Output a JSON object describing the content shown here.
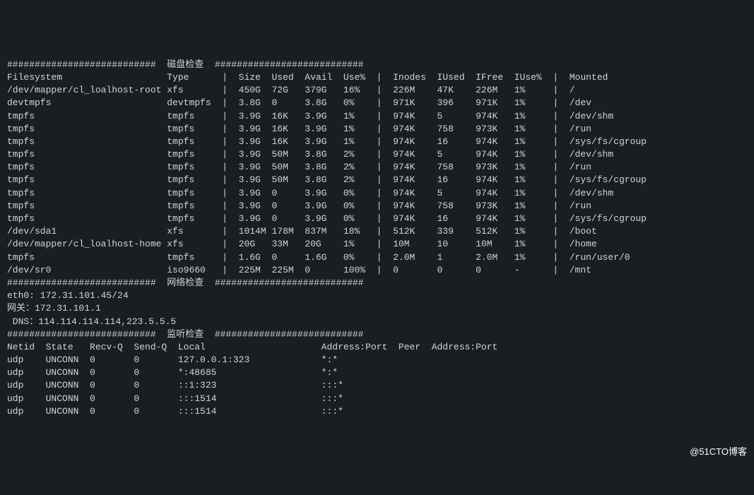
{
  "sections": {
    "disk": {
      "header_prefix": "###########################",
      "title": "磁盘检查",
      "header_suffix": "###########################",
      "columns": [
        "Filesystem",
        "Type",
        "Size",
        "Used",
        "Avail",
        "Use%",
        "Inodes",
        "IUsed",
        "IFree",
        "IUse%",
        "Mounted"
      ],
      "rows": [
        {
          "fs": "/dev/mapper/cl_loalhost-root",
          "type": "xfs",
          "size": "450G",
          "used": "72G",
          "avail": "379G",
          "usep": "16%",
          "inodes": "226M",
          "iused": "47K",
          "ifree": "226M",
          "iusep": "1%",
          "mounted": "/"
        },
        {
          "fs": "devtmpfs",
          "type": "devtmpfs",
          "size": "3.8G",
          "used": "0",
          "avail": "3.8G",
          "usep": "0%",
          "inodes": "971K",
          "iused": "396",
          "ifree": "971K",
          "iusep": "1%",
          "mounted": "/dev"
        },
        {
          "fs": "tmpfs",
          "type": "tmpfs",
          "size": "3.9G",
          "used": "16K",
          "avail": "3.9G",
          "usep": "1%",
          "inodes": "974K",
          "iused": "5",
          "ifree": "974K",
          "iusep": "1%",
          "mounted": "/dev/shm"
        },
        {
          "fs": "tmpfs",
          "type": "tmpfs",
          "size": "3.9G",
          "used": "16K",
          "avail": "3.9G",
          "usep": "1%",
          "inodes": "974K",
          "iused": "758",
          "ifree": "973K",
          "iusep": "1%",
          "mounted": "/run"
        },
        {
          "fs": "tmpfs",
          "type": "tmpfs",
          "size": "3.9G",
          "used": "16K",
          "avail": "3.9G",
          "usep": "1%",
          "inodes": "974K",
          "iused": "16",
          "ifree": "974K",
          "iusep": "1%",
          "mounted": "/sys/fs/cgroup"
        },
        {
          "fs": "tmpfs",
          "type": "tmpfs",
          "size": "3.9G",
          "used": "50M",
          "avail": "3.8G",
          "usep": "2%",
          "inodes": "974K",
          "iused": "5",
          "ifree": "974K",
          "iusep": "1%",
          "mounted": "/dev/shm"
        },
        {
          "fs": "tmpfs",
          "type": "tmpfs",
          "size": "3.9G",
          "used": "50M",
          "avail": "3.8G",
          "usep": "2%",
          "inodes": "974K",
          "iused": "758",
          "ifree": "973K",
          "iusep": "1%",
          "mounted": "/run"
        },
        {
          "fs": "tmpfs",
          "type": "tmpfs",
          "size": "3.9G",
          "used": "50M",
          "avail": "3.8G",
          "usep": "2%",
          "inodes": "974K",
          "iused": "16",
          "ifree": "974K",
          "iusep": "1%",
          "mounted": "/sys/fs/cgroup"
        },
        {
          "fs": "tmpfs",
          "type": "tmpfs",
          "size": "3.9G",
          "used": "0",
          "avail": "3.9G",
          "usep": "0%",
          "inodes": "974K",
          "iused": "5",
          "ifree": "974K",
          "iusep": "1%",
          "mounted": "/dev/shm"
        },
        {
          "fs": "tmpfs",
          "type": "tmpfs",
          "size": "3.9G",
          "used": "0",
          "avail": "3.9G",
          "usep": "0%",
          "inodes": "974K",
          "iused": "758",
          "ifree": "973K",
          "iusep": "1%",
          "mounted": "/run"
        },
        {
          "fs": "tmpfs",
          "type": "tmpfs",
          "size": "3.9G",
          "used": "0",
          "avail": "3.9G",
          "usep": "0%",
          "inodes": "974K",
          "iused": "16",
          "ifree": "974K",
          "iusep": "1%",
          "mounted": "/sys/fs/cgroup"
        },
        {
          "fs": "/dev/sda1",
          "type": "xfs",
          "size": "1014M",
          "used": "178M",
          "avail": "837M",
          "usep": "18%",
          "inodes": "512K",
          "iused": "339",
          "ifree": "512K",
          "iusep": "1%",
          "mounted": "/boot"
        },
        {
          "fs": "/dev/mapper/cl_loalhost-home",
          "type": "xfs",
          "size": "20G",
          "used": "33M",
          "avail": "20G",
          "usep": "1%",
          "inodes": "10M",
          "iused": "10",
          "ifree": "10M",
          "iusep": "1%",
          "mounted": "/home"
        },
        {
          "fs": "tmpfs",
          "type": "tmpfs",
          "size": "1.6G",
          "used": "0",
          "avail": "1.6G",
          "usep": "0%",
          "inodes": "2.0M",
          "iused": "1",
          "ifree": "2.0M",
          "iusep": "1%",
          "mounted": "/run/user/0"
        },
        {
          "fs": "/dev/sr0",
          "type": "iso9660",
          "size": "225M",
          "used": "225M",
          "avail": "0",
          "usep": "100%",
          "inodes": "0",
          "iused": "0",
          "ifree": "0",
          "iusep": "-",
          "mounted": "/mnt"
        }
      ]
    },
    "network": {
      "header_prefix": "###########################",
      "title": "网络检查",
      "header_suffix": "###########################",
      "eth_line": "eth0: 172.31.101.45/24",
      "gateway_label": "网关：",
      "gateway_value": "172.31.101.1",
      "dns_label": " DNS：",
      "dns_value": "114.114.114.114,223.5.5.5"
    },
    "listen": {
      "header_prefix": "###########################",
      "title": "监听检查",
      "header_suffix": "###########################",
      "columns": [
        "Netid",
        "State",
        "Recv-Q",
        "Send-Q",
        "Local",
        "Address:Port",
        "Peer",
        "Address:Port"
      ],
      "rows": [
        {
          "netid": "udp",
          "state": "UNCONN",
          "recvq": "0",
          "sendq": "0",
          "local": "127.0.0.1:323",
          "addrport": "*:*"
        },
        {
          "netid": "udp",
          "state": "UNCONN",
          "recvq": "0",
          "sendq": "0",
          "local": "*:48685",
          "addrport": "*:*"
        },
        {
          "netid": "udp",
          "state": "UNCONN",
          "recvq": "0",
          "sendq": "0",
          "local": "::1:323",
          "addrport": ":::*"
        },
        {
          "netid": "udp",
          "state": "UNCONN",
          "recvq": "0",
          "sendq": "0",
          "local": ":::1514",
          "addrport": ":::*"
        },
        {
          "netid": "udp",
          "state": "UNCONN",
          "recvq": "0",
          "sendq": "0",
          "local": ":::1514",
          "addrport": ":::*"
        }
      ]
    }
  },
  "watermark": "@51CTO博客"
}
